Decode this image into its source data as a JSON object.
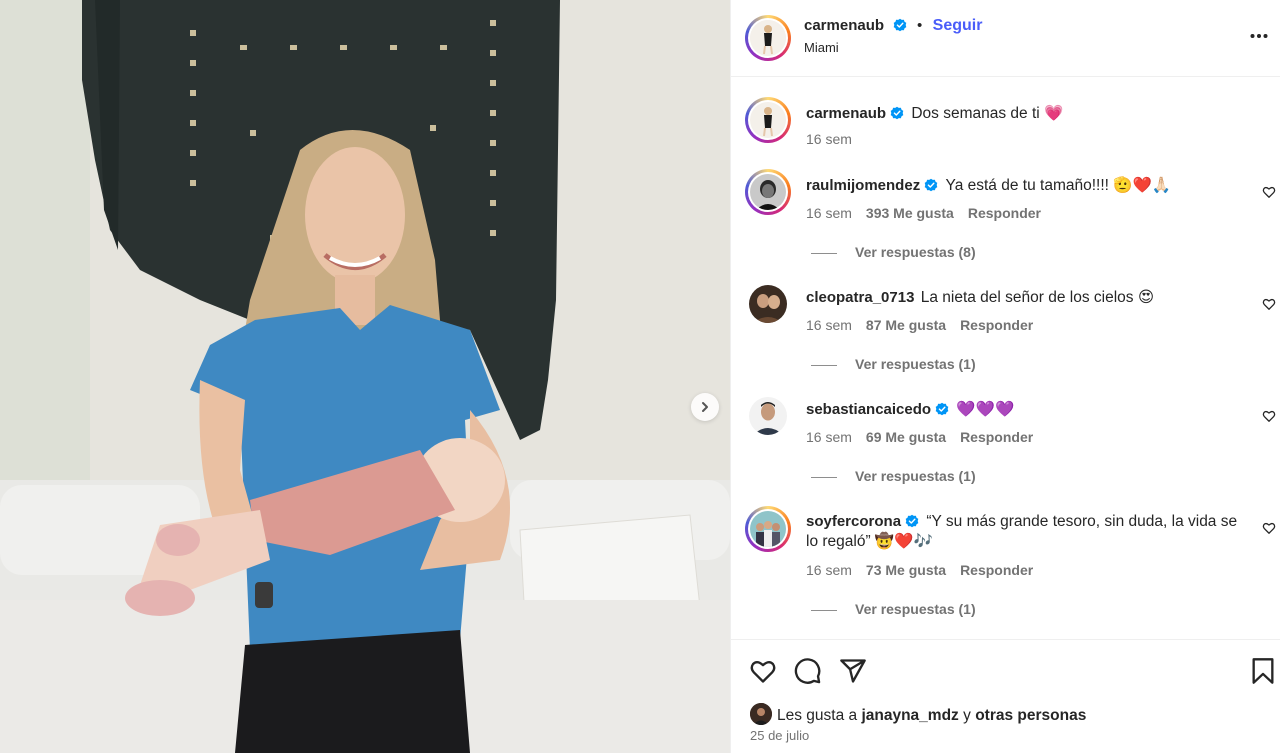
{
  "post": {
    "username": "carmenaub",
    "follow_label": "Seguir",
    "location": "Miami",
    "caption": "Dos semanas de ti 💗",
    "caption_age": "16 sem",
    "next_icon": "chevron-right-icon",
    "more_icon": "more-horizontal-icon"
  },
  "comments": [
    {
      "username": "raulmijomendez",
      "verified": true,
      "text": "Ya está de tu tamaño!!!! 🫡❤️🙏🏻",
      "age": "16 sem",
      "likes": "393 Me gusta",
      "reply_label": "Responder",
      "view_replies": "Ver respuestas (8)"
    },
    {
      "username": "cleopatra_0713",
      "verified": false,
      "text": "La nieta del señor de los cielos 😍",
      "age": "16 sem",
      "likes": "87 Me gusta",
      "reply_label": "Responder",
      "view_replies": "Ver respuestas (1)"
    },
    {
      "username": "sebastiancaicedo",
      "verified": true,
      "text": "💜💜💜",
      "age": "16 sem",
      "likes": "69 Me gusta",
      "reply_label": "Responder",
      "view_replies": "Ver respuestas (1)"
    },
    {
      "username": "soyfercorona",
      "verified": true,
      "text": "“Y su más grande tesoro, sin duda, la vida se lo regaló” 🤠❤️🎶",
      "age": "16 sem",
      "likes": "73 Me gusta",
      "reply_label": "Responder",
      "view_replies": "Ver respuestas (1)"
    }
  ],
  "actions": {
    "like_icon": "heart-icon",
    "comment_icon": "comment-icon",
    "share_icon": "send-icon",
    "save_icon": "bookmark-icon"
  },
  "likes_summary": {
    "prefix": "Les gusta a ",
    "user": "janayna_mdz",
    "middle": " y ",
    "others": "otras personas"
  },
  "date": "25 de julio",
  "colors": {
    "accent": "#4a5df9",
    "verified": "#0095f6",
    "muted": "#737373"
  }
}
